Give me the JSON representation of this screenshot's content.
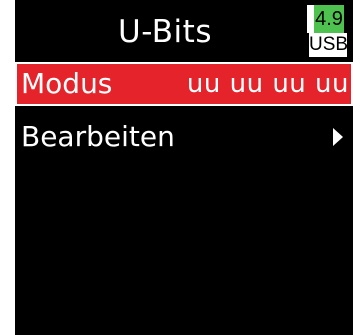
{
  "header": {
    "title": "U-Bits",
    "battery": {
      "voltage": "4.9",
      "source": "USB",
      "accent_color": "#4ec24e"
    }
  },
  "menu": {
    "items": [
      {
        "label": "Modus",
        "value": "uu uu uu uu",
        "selected": true
      },
      {
        "label": "Bearbeiten",
        "icon": "submenu-arrow-icon",
        "selected": false
      }
    ],
    "selected_color": "#e5232a"
  }
}
